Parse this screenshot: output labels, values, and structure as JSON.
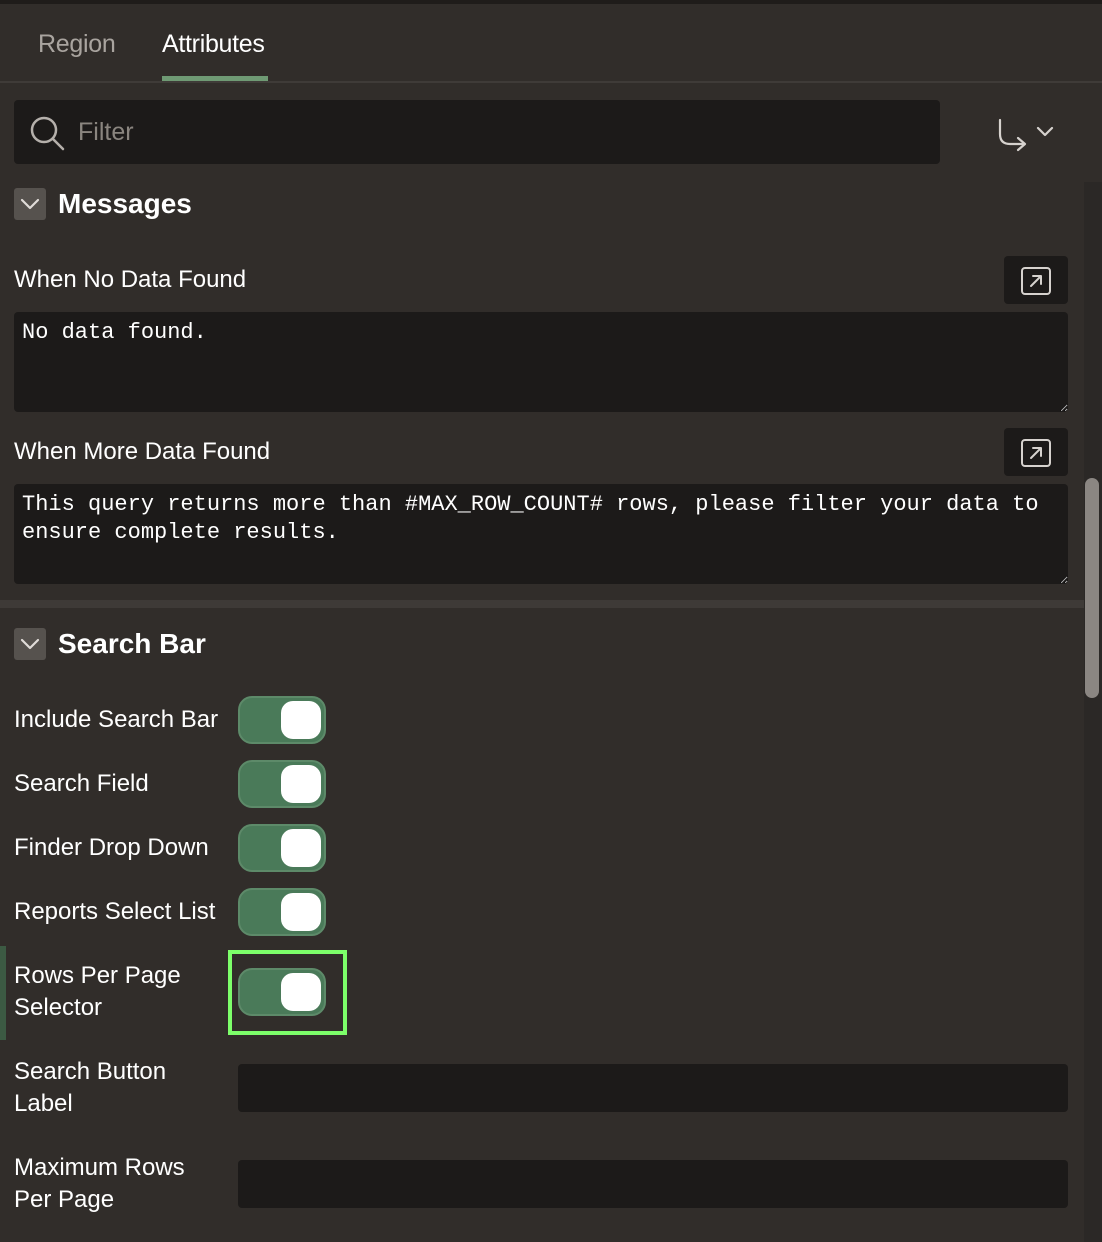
{
  "tabs": [
    {
      "label": "Region",
      "active": false
    },
    {
      "label": "Attributes",
      "active": true
    }
  ],
  "filter": {
    "placeholder": "Filter",
    "value": ""
  },
  "icons": {
    "search": "search-icon",
    "goto": "goto-group-icon",
    "chevron": "chevron-down-icon",
    "expand": "open-code-editor-icon"
  },
  "messages": {
    "title": "Messages",
    "no_data_found": {
      "label": "When No Data Found",
      "value": "No data found."
    },
    "more_data_found": {
      "label": "When More Data Found",
      "value": "This query returns more than #MAX_ROW_COUNT# rows, please filter your data to ensure complete results."
    }
  },
  "search_bar": {
    "title": "Search Bar",
    "toggles": [
      {
        "label": "Include Search Bar",
        "on": true
      },
      {
        "label": "Search Field",
        "on": true
      },
      {
        "label": "Finder Drop Down",
        "on": true
      },
      {
        "label": "Reports Select List",
        "on": true
      },
      {
        "label": "Rows Per Page Selector",
        "on": true
      }
    ],
    "search_button_label": {
      "label": "Search Button Label",
      "value": ""
    },
    "max_rows_per_page": {
      "label": "Maximum Rows Per Page",
      "value": ""
    }
  },
  "colors": {
    "background": "#312d2a",
    "field": "#1c1a19",
    "toggle_on": "#4a7a59",
    "tab_accent": "#6f9a74",
    "highlight": "#7dff6a"
  }
}
